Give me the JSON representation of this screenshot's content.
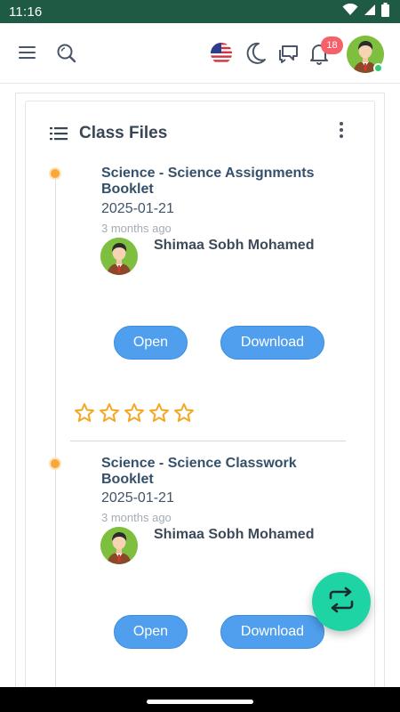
{
  "status_bar": {
    "time": "11:16",
    "icons": [
      "wifi-icon",
      "signal-icon",
      "battery-icon"
    ]
  },
  "topbar": {
    "icons": [
      "menu-icon",
      "search-icon",
      "us-flag-icon",
      "moon-icon",
      "chat-icon",
      "bell-icon",
      "user-avatar"
    ],
    "notification_count": "18",
    "online_color": "#2ecc71"
  },
  "card": {
    "title": "Class Files",
    "title_icon": "list-icon",
    "menu_icon": "kebab-menu-icon"
  },
  "files": [
    {
      "title": "Science - Science Assignments Booklet",
      "date": "2025-01-21",
      "ago": "3 months ago",
      "author": "Shimaa Sobh Mohamed",
      "open_label": "Open",
      "download_label": "Download",
      "rating": 0,
      "rating_max": 5
    },
    {
      "title": "Science - Science Classwork Booklet",
      "date": "2025-01-21",
      "ago": "3 months ago",
      "author": "Shimaa Sobh Mohamed",
      "open_label": "Open",
      "download_label": "Download"
    }
  ],
  "fab": {
    "icon": "swap-arrows-icon"
  },
  "colors": {
    "status_bar": "#1f5a45",
    "accent_button": "#4f9fee",
    "timeline_dot": "#f9a836",
    "star": "#f5a623",
    "fab": "#1ed4a4",
    "badge": "#f5606a"
  }
}
